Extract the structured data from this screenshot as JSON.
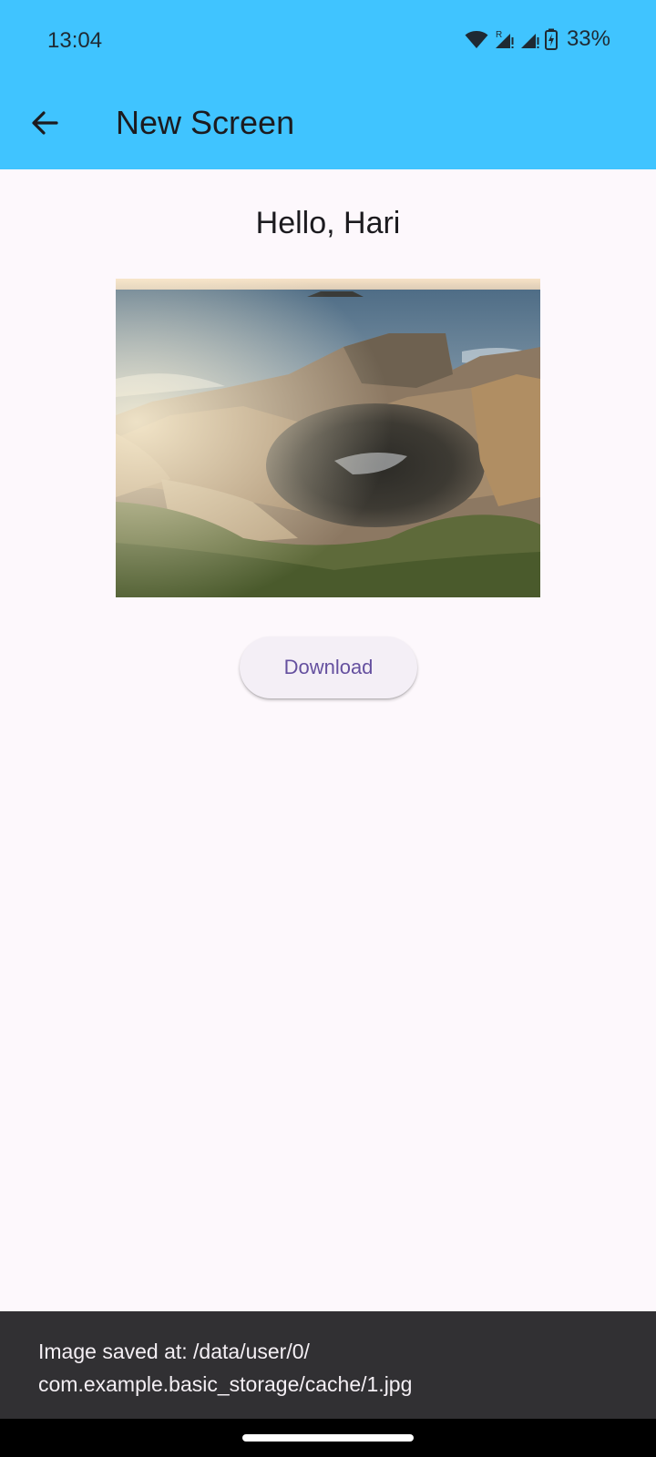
{
  "status_bar": {
    "time": "13:04",
    "battery_text": "33%",
    "roaming_indicator": "R",
    "icons": [
      "wifi-icon",
      "signal-roaming-icon",
      "signal-icon",
      "battery-charging-icon"
    ]
  },
  "app_bar": {
    "title": "New Screen",
    "back_icon": "arrow-back-icon",
    "background_color": "#40c4ff"
  },
  "main": {
    "greeting": "Hello, Hari",
    "image": {
      "subject": "coastal rock blowhole with ocean and sunset sky"
    },
    "download_label": "Download",
    "button_text_color": "#65509f"
  },
  "snackbar": {
    "line1": "Image saved at: /data/user/0/",
    "line2": "com.example.basic_storage/cache/1.jpg",
    "background_color": "#313033"
  }
}
